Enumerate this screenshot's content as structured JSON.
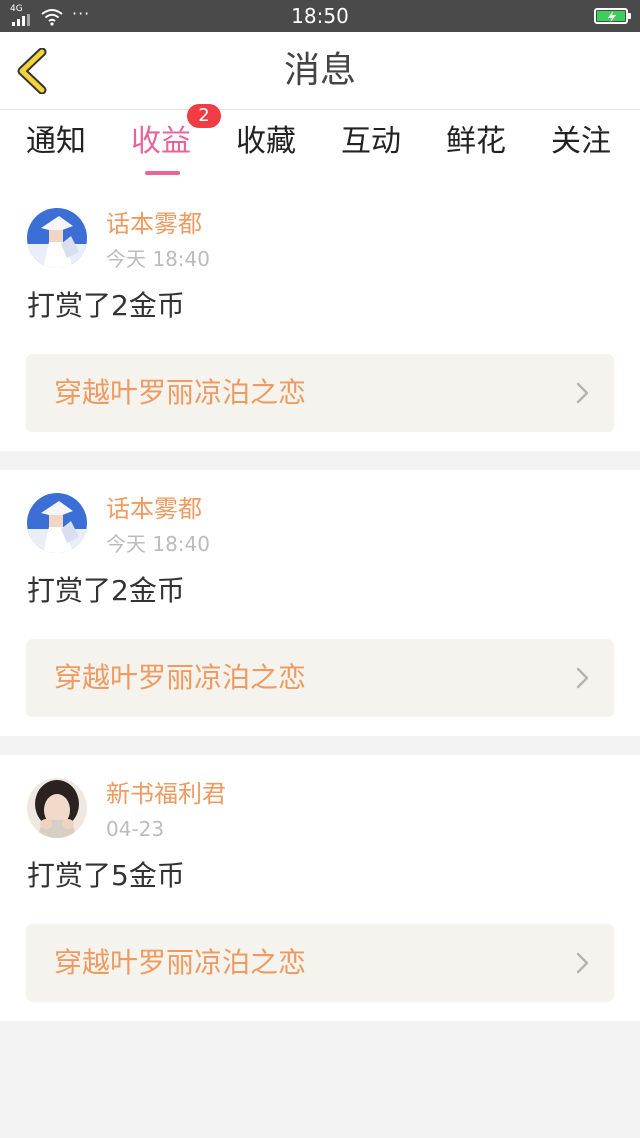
{
  "status": {
    "network": "4G",
    "time": "18:50",
    "more": "···"
  },
  "nav": {
    "title": "消息",
    "back_icon": "chevron-left-icon"
  },
  "tabs": [
    {
      "label": "通知",
      "active": false
    },
    {
      "label": "收益",
      "active": true,
      "badge": "2"
    },
    {
      "label": "收藏",
      "active": false
    },
    {
      "label": "互动",
      "active": false
    },
    {
      "label": "鲜花",
      "active": false
    },
    {
      "label": "关注",
      "active": false
    }
  ],
  "messages": [
    {
      "user": "话本雾都",
      "time": "今天 18:40",
      "text": "打赏了2金币",
      "book": "穿越叶罗丽凉泊之恋"
    },
    {
      "user": "话本雾都",
      "time": "今天 18:40",
      "text": "打赏了2金币",
      "book": "穿越叶罗丽凉泊之恋"
    },
    {
      "user": "新书福利君",
      "time": "04-23",
      "text": "打赏了5金币",
      "book": "穿越叶罗丽凉泊之恋"
    }
  ],
  "colors": {
    "accent": "#e8649a",
    "name": "#ef9a60",
    "badge": "#f03d45",
    "status_bar": "#4a4a4a",
    "back_icon": "#f5d33a"
  }
}
